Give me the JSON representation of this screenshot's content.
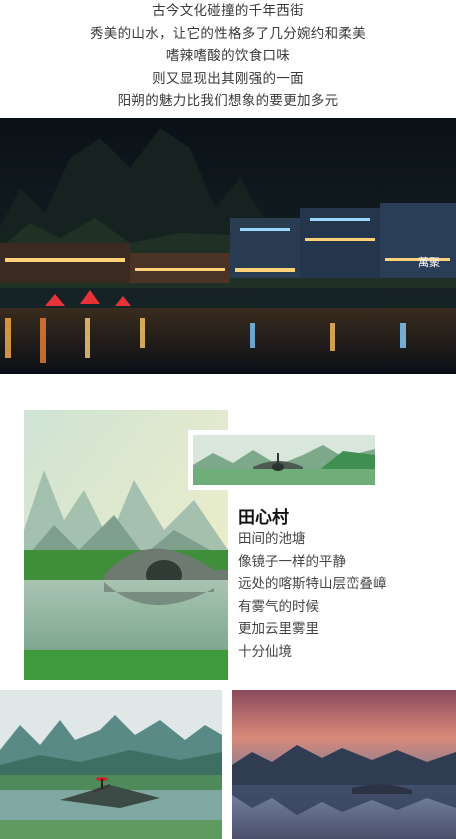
{
  "intro_lines": [
    "古今文化碰撞的千年西街",
    "秀美的山水，让它的性格多了几分婉约和柔美",
    "嗜辣嗜酸的饮食口味",
    "则又显现出其刚强的一面",
    "阳朔的魅力比我们想象的要更加多元"
  ],
  "village": {
    "title": "田心村",
    "lines": [
      "田间的池塘",
      "像镜子一样的平静",
      "远处的喀斯特山层峦叠嶂",
      "有雾气的时候",
      "更加云里雾里",
      "十分仙境"
    ]
  },
  "night_signs": [
    "萬聚"
  ],
  "colors": {
    "text": "#3a3a3a",
    "title": "#111111",
    "night_sky": "#0d1418",
    "mist_green": "#b9d2c4"
  }
}
